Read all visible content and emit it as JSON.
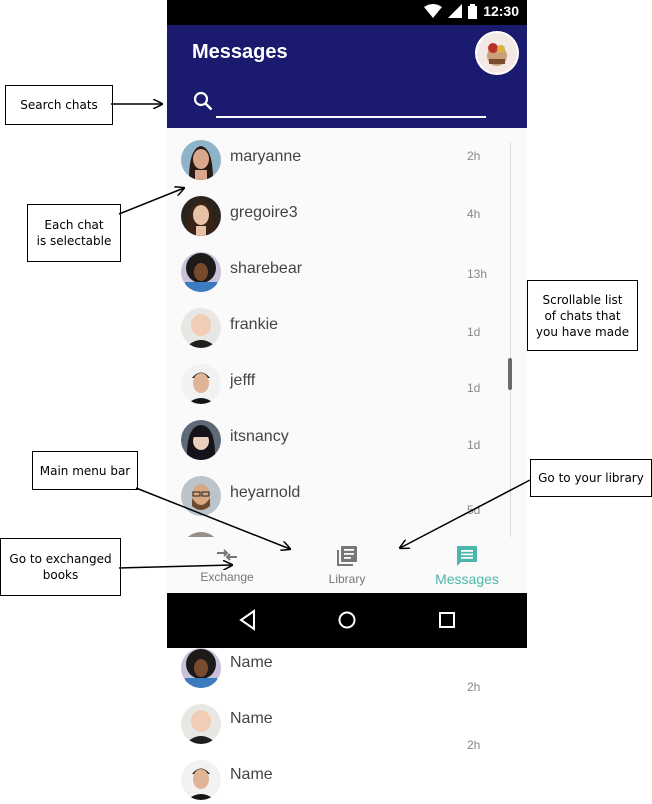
{
  "status_bar": {
    "time": "12:30"
  },
  "header": {
    "title": "Messages",
    "search_placeholder": ""
  },
  "chats": [
    {
      "name": "maryanne",
      "time": "2h",
      "avatar": "woman-dark-hair-avatar"
    },
    {
      "name": "gregoire3",
      "time": "4h",
      "avatar": "woman-long-hair-avatar"
    },
    {
      "name": "sharebear",
      "time": "13h",
      "avatar": "woman-curly-hair-avatar"
    },
    {
      "name": "frankie",
      "time": "1d",
      "avatar": "baby-avatar"
    },
    {
      "name": "jefff",
      "time": "1d",
      "avatar": "man-short-hair-avatar"
    },
    {
      "name": "itsnancy",
      "time": "1d",
      "avatar": "woman-bangs-avatar"
    },
    {
      "name": "heyarnold",
      "time": "5d",
      "avatar": "man-glasses-avatar"
    }
  ],
  "extra_items": [
    {
      "name": "Name",
      "time": "2h"
    },
    {
      "name": "Name",
      "time": "2h"
    },
    {
      "name": "Name",
      "time": ""
    }
  ],
  "bottom_nav": [
    {
      "label": "Exchange",
      "icon": "exchange-icon"
    },
    {
      "label": "Library",
      "icon": "library-icon"
    },
    {
      "label": "Messages",
      "icon": "message-icon",
      "active": true
    }
  ],
  "annotations": {
    "search": "Search chats",
    "selectable_1": "Each chat",
    "selectable_2": "is selectable",
    "scroll_1": "Scrollable list",
    "scroll_2": "of chats that",
    "scroll_3": "you have made",
    "menu": "Main menu bar",
    "library": "Go to your library",
    "exchanged_1": "Go to exchanged",
    "exchanged_2": "books"
  },
  "colors": {
    "header": "#1a1a6e",
    "active": "#4db6ac",
    "status_bar": "#000000"
  }
}
